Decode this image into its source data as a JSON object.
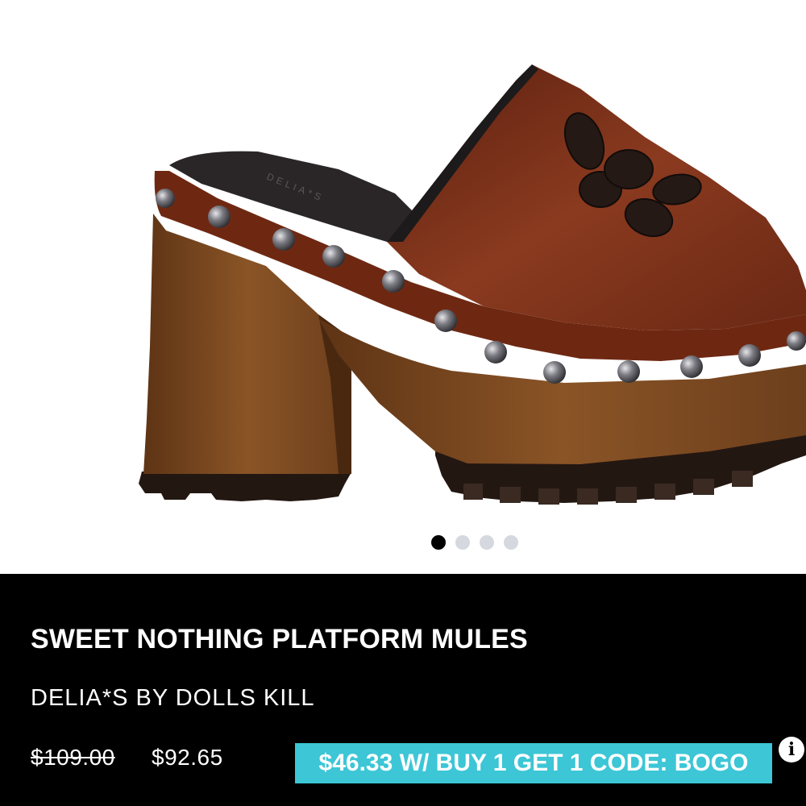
{
  "product": {
    "title": "SWEET NOTHING PLATFORM MULES",
    "brand": "DELIA*S BY DOLLS KILL",
    "original_price": "$109.00",
    "sale_price": "$92.65",
    "promo": "$46.33 W/ BUY 1 GET 1 CODE: BOGO",
    "info_icon": "info-icon"
  },
  "image": {
    "insole_brand": "DELIA*S",
    "description_icon": "platform-mule-photo"
  },
  "carousel": {
    "total": 4,
    "active_index": 0
  },
  "colors": {
    "leather": "#7a2e1a",
    "wood": "#7b4a22",
    "promo_bg": "#3cc6d6",
    "info_bg": "#000000"
  }
}
